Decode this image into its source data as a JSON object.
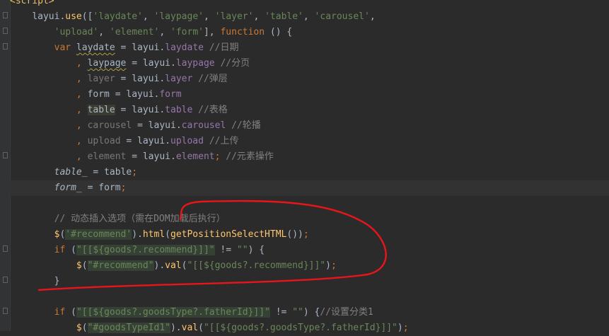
{
  "editor": {
    "lines": [
      {
        "indent": "",
        "tokens": [
          [
            "tag",
            "<script>"
          ]
        ]
      },
      {
        "indent": "    ",
        "tokens": [
          [
            "var",
            "layui."
          ],
          [
            "fn",
            "use"
          ],
          [
            "var",
            "(["
          ],
          [
            "str",
            "'laydate'"
          ],
          [
            "var",
            ", "
          ],
          [
            "str",
            "'laypage'"
          ],
          [
            "var",
            ", "
          ],
          [
            "str",
            "'layer'"
          ],
          [
            "var",
            ", "
          ],
          [
            "str",
            "'table'"
          ],
          [
            "var",
            ", "
          ],
          [
            "str",
            "'carousel'"
          ],
          [
            "var",
            ","
          ]
        ]
      },
      {
        "indent": "        ",
        "tokens": [
          [
            "str",
            "'upload'"
          ],
          [
            "var",
            ", "
          ],
          [
            "str",
            "'element'"
          ],
          [
            "var",
            ", "
          ],
          [
            "str",
            "'form'"
          ],
          [
            "var",
            "], "
          ],
          [
            "kw",
            "function"
          ],
          [
            "var",
            " () {"
          ]
        ]
      },
      {
        "indent": "        ",
        "tokens": [
          [
            "kw",
            "var "
          ],
          [
            "squig",
            "laydate"
          ],
          [
            "var",
            " = layui."
          ],
          [
            "prop",
            "laydate"
          ],
          [
            "cm",
            " //日期"
          ]
        ]
      },
      {
        "indent": "            ",
        "tokens": [
          [
            "kw",
            ", "
          ],
          [
            "squig",
            "laypage"
          ],
          [
            "var",
            " = layui."
          ],
          [
            "prop",
            "laypage"
          ],
          [
            "cm",
            " //分页"
          ]
        ]
      },
      {
        "indent": "            ",
        "tokens": [
          [
            "kw",
            ", "
          ],
          [
            "unused",
            "layer"
          ],
          [
            "var",
            " = layui."
          ],
          [
            "prop",
            "layer"
          ],
          [
            "cm",
            " //弹层"
          ]
        ]
      },
      {
        "indent": "            ",
        "tokens": [
          [
            "kw",
            ", "
          ],
          [
            "var",
            "form = layui."
          ],
          [
            "prop",
            "form"
          ]
        ]
      },
      {
        "indent": "            ",
        "tokens": [
          [
            "kw",
            ", "
          ],
          [
            "mark",
            "table"
          ],
          [
            "var",
            " = layui."
          ],
          [
            "prop",
            "table"
          ],
          [
            "cm",
            " //表格"
          ]
        ]
      },
      {
        "indent": "            ",
        "tokens": [
          [
            "kw",
            ", "
          ],
          [
            "unused",
            "carousel"
          ],
          [
            "var",
            " = layui."
          ],
          [
            "prop",
            "carousel"
          ],
          [
            "cm",
            " //轮播"
          ]
        ]
      },
      {
        "indent": "            ",
        "tokens": [
          [
            "kw",
            ", "
          ],
          [
            "unused",
            "upload"
          ],
          [
            "var",
            " = layui."
          ],
          [
            "prop",
            "upload"
          ],
          [
            "cm",
            " //上传"
          ]
        ]
      },
      {
        "indent": "            ",
        "tokens": [
          [
            "kw",
            ", "
          ],
          [
            "unused",
            "element"
          ],
          [
            "var",
            " = layui."
          ],
          [
            "prop",
            "element"
          ],
          [
            "kw",
            "; "
          ],
          [
            "cm",
            "//元素操作"
          ]
        ]
      },
      {
        "indent": "        ",
        "tokens": [
          [
            "it",
            "table_"
          ],
          [
            "var",
            " = table"
          ],
          [
            "kw",
            ";"
          ]
        ]
      },
      {
        "indent": "        ",
        "tokens": [
          [
            "it",
            "form_"
          ],
          [
            "var",
            " = form"
          ],
          [
            "kw",
            ";"
          ]
        ]
      },
      {
        "indent": "",
        "tokens": []
      },
      {
        "indent": "        ",
        "tokens": [
          [
            "cm",
            "// 动态插入选项（需在DOM加载后执行）"
          ]
        ]
      },
      {
        "indent": "        ",
        "tokens": [
          [
            "fn",
            "$"
          ],
          [
            "var",
            "("
          ],
          [
            "strbg",
            "'#recommend'"
          ],
          [
            "var",
            ")."
          ],
          [
            "fn",
            "html"
          ],
          [
            "var",
            "("
          ],
          [
            "fn",
            "getPositionSelectHTML"
          ],
          [
            "var",
            "())"
          ],
          [
            "kw",
            ";"
          ]
        ]
      },
      {
        "indent": "        ",
        "tokens": [
          [
            "kw",
            "if "
          ],
          [
            "var",
            "("
          ],
          [
            "strbg",
            "\"[[${goods?.recommend}]]\""
          ],
          [
            "var",
            " != "
          ],
          [
            "str",
            "\"\""
          ],
          [
            "var",
            ") {"
          ]
        ]
      },
      {
        "indent": "            ",
        "tokens": [
          [
            "fn",
            "$"
          ],
          [
            "var",
            "("
          ],
          [
            "strbg",
            "\"#recommend\""
          ],
          [
            "var",
            ")."
          ],
          [
            "fn",
            "val"
          ],
          [
            "var",
            "("
          ],
          [
            "str",
            "\"[[${goods?.recommend}]]\""
          ],
          [
            "var",
            ")"
          ],
          [
            "kw",
            ";"
          ]
        ]
      },
      {
        "indent": "        ",
        "tokens": [
          [
            "var",
            "}"
          ]
        ]
      },
      {
        "indent": "",
        "tokens": []
      },
      {
        "indent": "        ",
        "tokens": [
          [
            "kw",
            "if "
          ],
          [
            "var",
            "("
          ],
          [
            "strbg",
            "\"[[${goods?.goodsType?.fatherId}]]\""
          ],
          [
            "var",
            " != "
          ],
          [
            "str",
            "\"\""
          ],
          [
            "var",
            ") {"
          ],
          [
            "cm",
            "//设置分类1"
          ]
        ]
      },
      {
        "indent": "            ",
        "tokens": [
          [
            "fn",
            "$"
          ],
          [
            "var",
            "("
          ],
          [
            "strbg",
            "\"#goodsTypeId1\""
          ],
          [
            "var",
            ")."
          ],
          [
            "fn",
            "val"
          ],
          [
            "var",
            "("
          ],
          [
            "str",
            "\"[[${goods?.goodsType?.fatherId}]]\""
          ],
          [
            "var",
            ")"
          ],
          [
            "kw",
            ";"
          ]
        ]
      }
    ]
  },
  "colors": {
    "background": "#2b2b2b",
    "annotation": "#e8151b"
  }
}
